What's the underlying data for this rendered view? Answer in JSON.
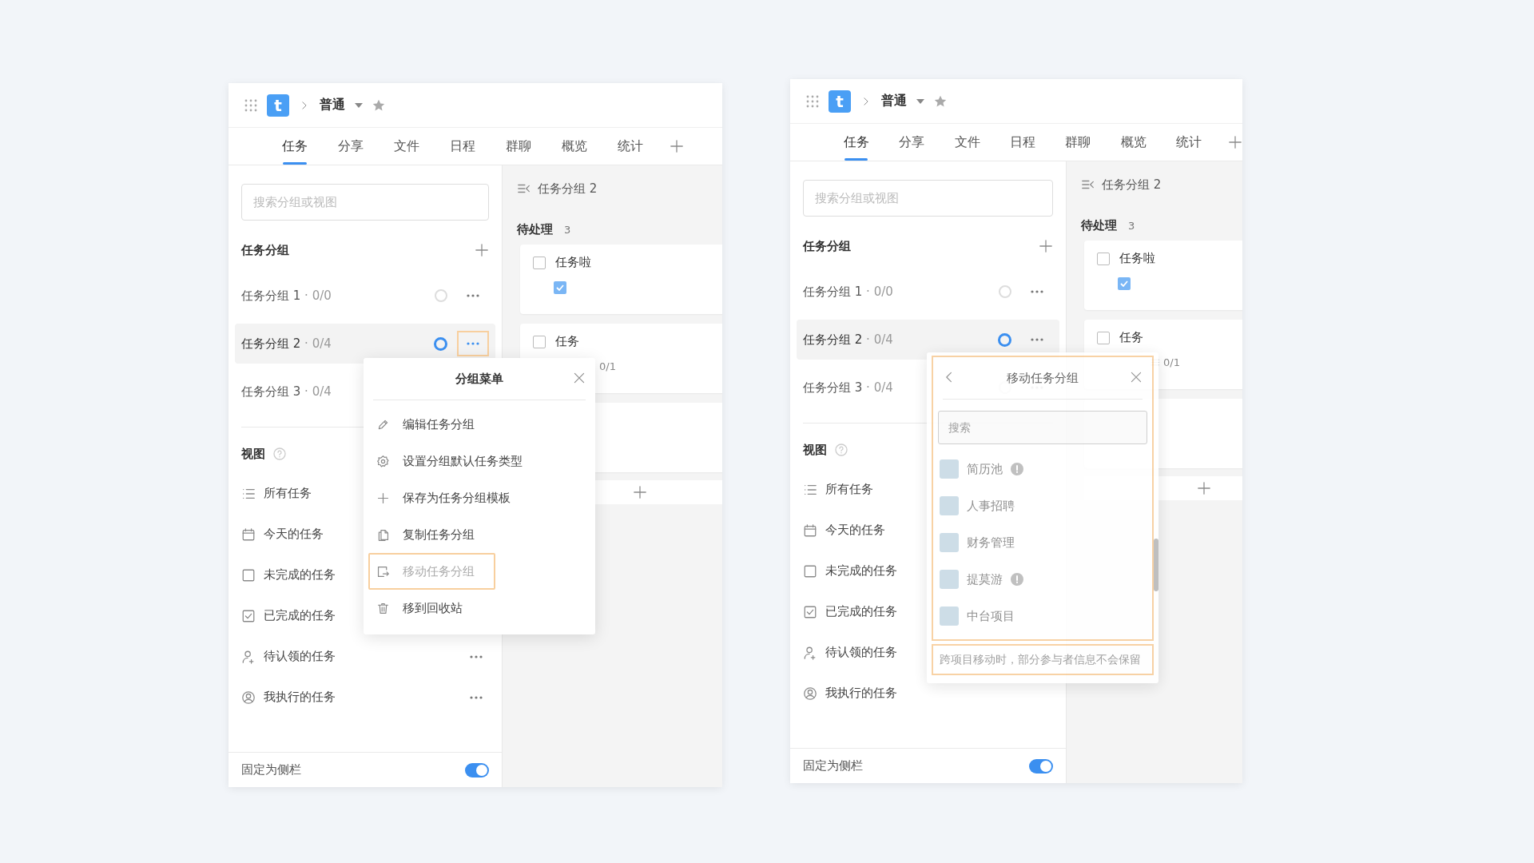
{
  "screens": [
    {
      "app": {
        "logo": "t",
        "project": "普通"
      },
      "tabs": [
        {
          "label": "任务",
          "selected": true
        },
        {
          "label": "分享",
          "selected": false
        },
        {
          "label": "文件",
          "selected": false
        },
        {
          "label": "日程",
          "selected": false
        },
        {
          "label": "群聊",
          "selected": false
        },
        {
          "label": "概览",
          "selected": false
        },
        {
          "label": "统计",
          "selected": false
        }
      ],
      "sidebar": {
        "search": {
          "placeholder": "搜索分组或视图"
        },
        "groups_title": "任务分组",
        "groups": [
          {
            "name": "任务分组 1",
            "count": "· 0/0",
            "selected": false
          },
          {
            "name": "任务分组 2",
            "count": "· 0/4",
            "selected": true,
            "highlighted": true
          },
          {
            "name": "任务分组 3",
            "count": "· 0/4",
            "selected": false
          }
        ],
        "views_title": "视图",
        "views": [
          {
            "kind": "all",
            "label": "所有任务",
            "more": false
          },
          {
            "kind": "today",
            "label": "今天的任务",
            "more": false
          },
          {
            "kind": "incomplete",
            "label": "未完成的任务",
            "more": false
          },
          {
            "kind": "done",
            "label": "已完成的任务",
            "more": false
          },
          {
            "kind": "unclaimed",
            "label": "待认领的任务",
            "more": true
          },
          {
            "kind": "mine",
            "label": "我执行的任务",
            "more": true
          }
        ],
        "pin": {
          "label": "固定为侧栏",
          "on": true
        }
      },
      "board": {
        "title": "任务分组 2",
        "column": {
          "title": "待处理",
          "count": "3"
        },
        "cards": [
          {
            "kind": "task",
            "title": "任务啦",
            "checked": false,
            "subtask_checked": true
          },
          {
            "kind": "task",
            "title": "任务",
            "checked": false,
            "subtasks": "0/1"
          },
          {
            "kind": "hidden"
          }
        ]
      },
      "popup": {
        "kind": "menu",
        "title": "分组菜单",
        "items": [
          {
            "kind": "edit",
            "label": "编辑任务分组",
            "highlighted": false
          },
          {
            "kind": "settings",
            "label": "设置分组默认任务类型",
            "highlighted": false
          },
          {
            "kind": "add",
            "label": "保存为任务分组模板",
            "highlighted": false
          },
          {
            "kind": "copy",
            "label": "复制任务分组",
            "highlighted": false
          },
          {
            "kind": "move",
            "label": "移动任务分组",
            "highlighted": true
          },
          {
            "kind": "trash",
            "label": "移到回收站",
            "highlighted": false
          }
        ]
      }
    },
    {
      "app": {
        "logo": "t",
        "project": "普通"
      },
      "tabs": [
        {
          "label": "任务",
          "selected": true
        },
        {
          "label": "分享",
          "selected": false
        },
        {
          "label": "文件",
          "selected": false
        },
        {
          "label": "日程",
          "selected": false
        },
        {
          "label": "群聊",
          "selected": false
        },
        {
          "label": "概览",
          "selected": false
        },
        {
          "label": "统计",
          "selected": false
        }
      ],
      "sidebar": {
        "search": {
          "placeholder": "搜索分组或视图"
        },
        "groups_title": "任务分组",
        "groups": [
          {
            "name": "任务分组 1",
            "count": "· 0/0",
            "selected": false
          },
          {
            "name": "任务分组 2",
            "count": "· 0/4",
            "selected": true
          },
          {
            "name": "任务分组 3",
            "count": "· 0/4",
            "selected": false
          }
        ],
        "views_title": "视图",
        "views": [
          {
            "kind": "all",
            "label": "所有任务",
            "more": false
          },
          {
            "kind": "today",
            "label": "今天的任务",
            "more": false
          },
          {
            "kind": "incomplete",
            "label": "未完成的任务",
            "more": false
          },
          {
            "kind": "done",
            "label": "已完成的任务",
            "more": false
          },
          {
            "kind": "unclaimed",
            "label": "待认领的任务",
            "more": false
          },
          {
            "kind": "mine",
            "label": "我执行的任务",
            "more": false
          }
        ],
        "pin": {
          "label": "固定为侧栏",
          "on": true
        }
      },
      "board": {
        "title": "任务分组 2",
        "column": {
          "title": "待处理",
          "count": "3"
        },
        "cards": [
          {
            "kind": "task",
            "title": "任务啦",
            "checked": false,
            "subtask_checked": true
          },
          {
            "kind": "task",
            "title": "任务",
            "checked": false,
            "subtasks": "0/1"
          },
          {
            "kind": "hidden"
          }
        ]
      },
      "popup": {
        "kind": "move",
        "title": "移动任务分组",
        "search": {
          "placeholder": "搜索"
        },
        "highlighted": true,
        "projects": [
          {
            "name": "简历池",
            "warning": true
          },
          {
            "name": "人事招聘",
            "warning": false
          },
          {
            "name": "财务管理",
            "warning": false
          },
          {
            "name": "提莫游",
            "warning": true
          },
          {
            "name": "中台项目",
            "warning": false
          }
        ],
        "note": "跨项目移动时，部分参与者信息不会保留",
        "note_highlighted": true
      }
    }
  ]
}
